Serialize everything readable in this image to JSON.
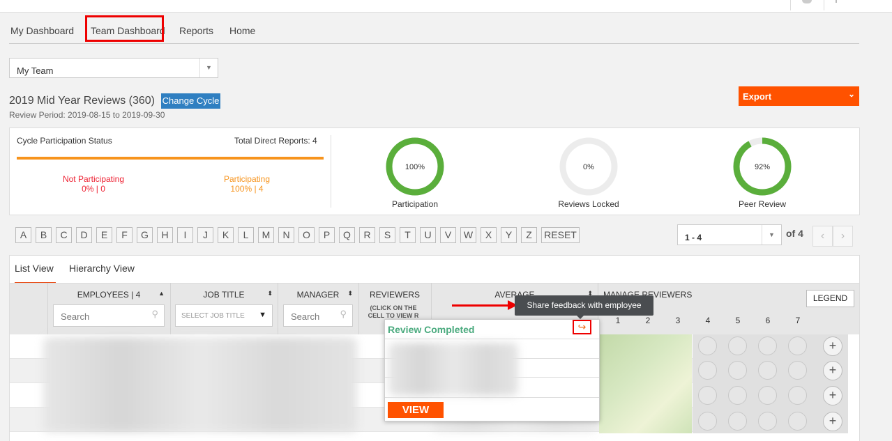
{
  "nav": {
    "tabs": [
      "My Dashboard",
      "Team Dashboard",
      "Reports",
      "Home"
    ]
  },
  "team_select": {
    "value": "My Team"
  },
  "cycle": {
    "title": "2019 Mid Year Reviews (360)",
    "change_label": "Change Cycle",
    "review_period": "Review Period: 2019-08-15 to 2019-09-30",
    "export_label": "Export"
  },
  "participation": {
    "title": "Cycle Participation Status",
    "total_direct_reports": "Total Direct Reports: 4",
    "not_participating_label": "Not Participating",
    "not_participating_value": "0% | 0",
    "participating_label": "Participating",
    "participating_value": "100% | 4"
  },
  "rings": [
    {
      "value_text": "100%",
      "label": "Participation",
      "fraction": 1.0,
      "color": "#5aae3b"
    },
    {
      "value_text": "0%",
      "label": "Reviews Locked",
      "fraction": 0.0,
      "color": "#5aae3b"
    },
    {
      "value_text": "92%",
      "label": "Peer Review",
      "fraction": 0.92,
      "color": "#5aae3b"
    }
  ],
  "alphabet": [
    "A",
    "B",
    "C",
    "D",
    "E",
    "F",
    "G",
    "H",
    "I",
    "J",
    "K",
    "L",
    "M",
    "N",
    "O",
    "P",
    "Q",
    "R",
    "S",
    "T",
    "U",
    "V",
    "W",
    "X",
    "Y",
    "Z",
    "RESET"
  ],
  "pagination": {
    "range": "1 - 4",
    "of": "of 4"
  },
  "views": {
    "list": "List View",
    "hierarchy": "Hierarchy View"
  },
  "table": {
    "col_employees": "EMPLOYEES | 4",
    "col_job_title": "JOB TITLE",
    "col_manager": "MANAGER",
    "col_reviewers": "REVIEWERS",
    "reviewers_hint": "(CLICK ON THE CELL TO VIEW R",
    "col_average": "AVERAGE",
    "col_manage_reviewers": "MANAGE REVIEWERS",
    "legend_label": "LEGEND",
    "search_placeholder": "Search",
    "job_title_placeholder": "SELECT JOB TITLE",
    "reviewer_numbers": [
      "1",
      "2",
      "3",
      "4",
      "5",
      "6",
      "7"
    ]
  },
  "tooltip": {
    "text": "Share feedback with employee"
  },
  "popup": {
    "status": "Review Completed",
    "view_label": "VIEW"
  },
  "colors": {
    "accent_orange": "#ff5200",
    "brand_blue": "#2f7fc1",
    "highlight_red": "#ee0000",
    "ring_green": "#5aae3b"
  }
}
